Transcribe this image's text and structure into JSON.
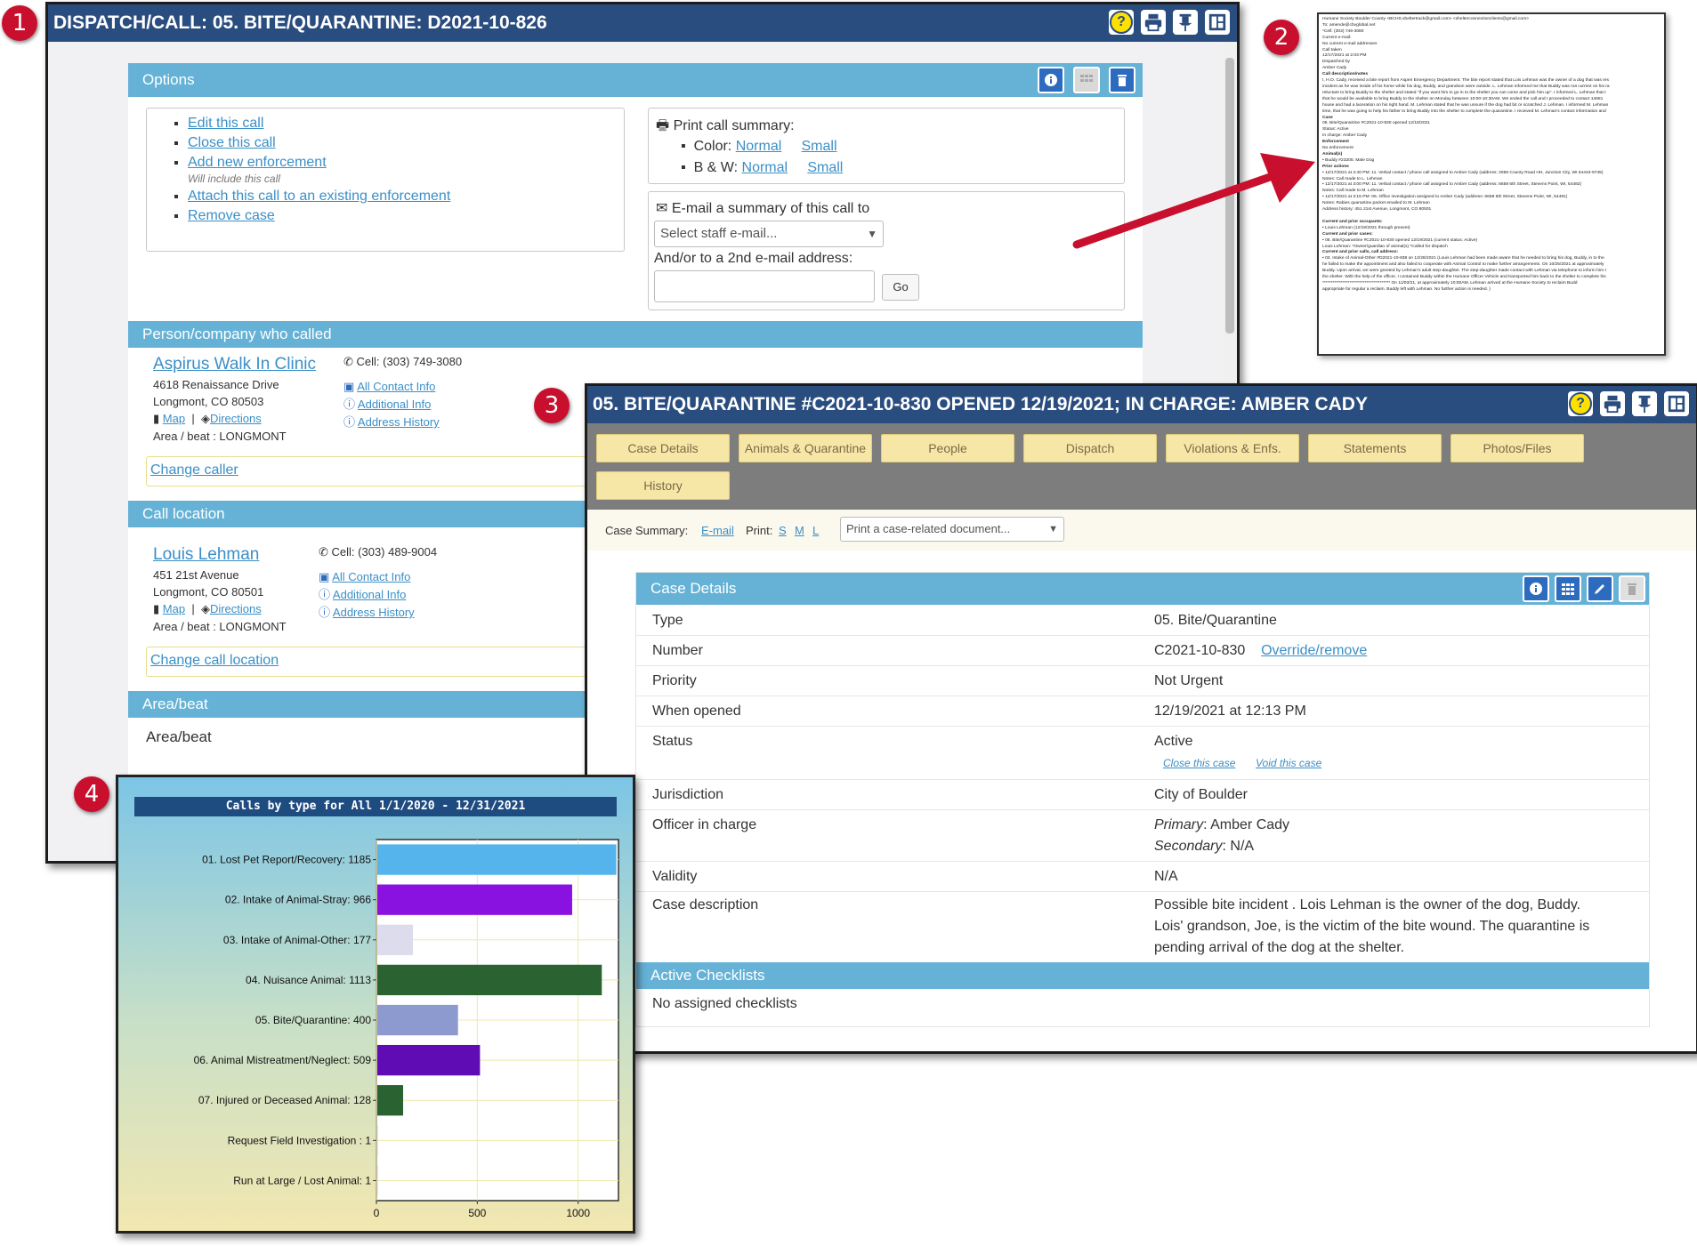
{
  "badges": [
    "1",
    "2",
    "3",
    "4"
  ],
  "dispatch": {
    "title": "DISPATCH/CALL: 05. BITE/QUARANTINE: D2021-10-826",
    "options_title": "Options",
    "options": [
      {
        "label": "Edit this call"
      },
      {
        "label": "Close this call"
      },
      {
        "label": "Add new enforcement",
        "note": "Will include this call"
      },
      {
        "label": "Attach this call to an existing enforcement"
      },
      {
        "label": "Remove case"
      }
    ],
    "print_summary": {
      "label": "Print call summary:",
      "color_label": "Color:",
      "normal": "Normal",
      "small": "Small",
      "bw_label": "B & W:"
    },
    "email_summary": {
      "label": "E-mail a summary of this call to",
      "select_placeholder": "Select staff e-mail...",
      "second_label": "And/or to a 2nd e-mail address:",
      "go": "Go"
    },
    "caller_section": "Person/company who called",
    "caller": {
      "name": "Aspirus Walk In Clinic",
      "address1": "4618 Renaissance Drive",
      "address2": "Longmont, CO 80503",
      "map": "Map",
      "sep": "|",
      "directions": "Directions",
      "area": "Area / beat : LONGMONT",
      "cell": "Cell: (303) 749-3080",
      "links": [
        "All Contact Info",
        "Additional Info",
        "Address History"
      ],
      "change": "Change caller"
    },
    "location_section": "Call location",
    "location": {
      "name": "Louis Lehman",
      "address1": "451 21st Avenue",
      "address2": "Longmont, CO 80501",
      "map": "Map",
      "sep": "|",
      "directions": "Directions",
      "area": "Area / beat : LONGMONT",
      "cell": "Cell: (303) 489-9004",
      "links": [
        "All Contact Info",
        "Additional Info",
        "Address History"
      ],
      "change": "Change call location"
    },
    "area_section": "Area/beat",
    "area_value": "Area/beat"
  },
  "email_doc": {
    "lines": [
      "Humane Society Boulder County <BCHS.sheltertrack@gmail.com> <shelterconnectionclients@gmail.com>",
      "To: amende@cbvglobal.net",
      "*Cell: (303) 749-3080",
      "Current e-mail:",
      "No current e-mail addresses",
      "Call taken",
      "12/17/2021 at 2:03 PM",
      "Dispatched by",
      "Amber Cady",
      "Call description/notes",
      "I, H.O. Cady, received a bite report from Aspen Emergency Department. The bite report stated that Lois Lehman was the owner of a dog that was res",
      "incident as he was inside of his home while his dog, Buddy, and grandson were outside. L. Lehman informed me that Buddy was not current on his ra",
      "reluctant to bring Buddy to the shelter and stated \"if you want him to go in to the shelter you can come and pick him up\". I informed L. Lehman that t",
      "that he would be available to bring Buddy to the shelter on Monday between 10:00-10:30AM. We ended the call and I proceeded to contact 14681",
      "house and had a laceration on his right hand. M. Lehman stated that he was unsure if the dog had bit or scratched J. Lehman. I informed M. Lehman",
      "time, that he was going to help his father to bring Buddy into the shelter to complete the quarantine. I received M. Lehman's contact information and",
      "Case",
      "05. Bite/Quarantine #C2021-10-830 opened 12/19/2021",
      "Status: Active",
      "In charge: Amber Cady",
      "Enforcement",
      "No enforcement",
      "Animal(s)",
      "• Buddy #23205: Male Dog",
      "Prior actions",
      "• 12/17/2021 at 2:40 PM: 11. Verbal contact / phone call assigned to Amber Cady (address: 2955 County Road HH, Junction City, WI 54443-9745)",
      "Notes: Call made to L. Lehman",
      "• 12/17/2021 at 3:00 PM: 11. Verbal contact / phone call assigned to Amber Cady (address: 6658 6th Street, Stevens Point, WI, 54482)",
      "Notes: Call made to M. Lehman",
      "• 12/17/2021 at 3:15 PM: 06. Office investigation assigned to Amber Cady (address: 6658 6th Street, Stevens Point, WI, 54481)",
      "Notes: Rabies quarantine packet emailed to M. Lehman",
      "Address history: 451 21st Avenue, Longmont, CO 80501",
      "",
      "Current and prior occupants:",
      "• Louis Lehman (12/19/2021 through present)",
      "Current and prior cases:",
      "• 05. Bite/Quarantine #C2021-10-830 opened 12/19/2021 (current status: Active)",
      "Louis Lehman: *Owner/guardian of animal(s) *Called for dispatch",
      "Current and prior calls, call address:",
      "• 03. Intake of Animal-Other #D2021-10-838 on 12/28/2021 (Louis Lehman had been made aware that he needed to bring his dog, Buddy, in to the",
      "he failed to make the appointment and also failed to cooperate with Animal Control to make further arrangements. On 10/25/2021 at approximately",
      "Buddy. Upon arrival, we were greeted by Lehman's adult step-daughter. The step-daughter made contact with Lehman via telephone to inform him t",
      "the shelter. With the help of the officer, I contained Buddy within the Humane Officer Vehicle and transported him back to the shelter to complete his",
      "**************************************** On 11/03/21, at approximately 10:00AM, Lehman arrived at the Humane Society to reclaim Budd",
      "appropriate for regular a reclaim. Buddy left with Lehman. No further action is needed. )"
    ]
  },
  "case": {
    "title": "05. BITE/QUARANTINE #C2021-10-830 OPENED 12/19/2021; IN CHARGE: AMBER CADY",
    "tabs": [
      "Case Details",
      "Animals & Quarantine",
      "People",
      "Dispatch",
      "Violations & Enfs.",
      "Statements",
      "Photos/Files",
      "History"
    ],
    "summary_label": "Case Summary:",
    "email": "E-mail",
    "print_label": "Print:",
    "print_s": "S",
    "print_m": "M",
    "print_l": "L",
    "doc_select": "Print a case-related document...",
    "details_title": "Case Details",
    "rows": {
      "type": {
        "k": "Type",
        "v": "05. Bite/Quarantine"
      },
      "number": {
        "k": "Number",
        "v": "C2021-10-830",
        "link": "Override/remove"
      },
      "priority": {
        "k": "Priority",
        "v": "Not Urgent"
      },
      "opened": {
        "k": "When opened",
        "v": "12/19/2021 at 12:13 PM"
      },
      "status": {
        "k": "Status",
        "v": "Active",
        "close": "Close this case",
        "void": "Void this case"
      },
      "jurisdiction": {
        "k": "Jurisdiction",
        "v": "City of Boulder"
      },
      "officer": {
        "k": "Officer in charge",
        "primary_label": "Primary",
        "primary": ": Amber Cady",
        "secondary_label": "Secondary",
        "secondary": ": N/A"
      },
      "validity": {
        "k": "Validity",
        "v": "N/A"
      },
      "description": {
        "k": "Case description",
        "v1": "Possible bite incident . Lois Lehman is the owner of the dog, Buddy.",
        "v2": "Lois' grandson, Joe, is the victim of the bite wound. The quarantine is",
        "v3": "pending arrival of the dog at the shelter."
      }
    },
    "checklists_title": "Active Checklists",
    "checklists_value": "No assigned checklists"
  },
  "chart_data": {
    "type": "bar",
    "orientation": "horizontal",
    "title": "Calls by type for All 1/1/2020 - 12/31/2021",
    "categories": [
      "01. Lost Pet Report/Recovery: 1185",
      "02. Intake of Animal-Stray: 966",
      "03. Intake of Animal-Other: 177",
      "04. Nuisance Animal: 1113",
      "05. Bite/Quarantine: 400",
      "06. Animal Mistreatment/Neglect: 509",
      "07. Injured or Deceased Animal: 128",
      "Request Field Investigation : 1",
      "Run at Large / Lost Animal: 1"
    ],
    "values": [
      1185,
      966,
      177,
      1113,
      400,
      509,
      128,
      1,
      1
    ],
    "colors": [
      "#55b4ec",
      "#8a12e0",
      "#dcdcec",
      "#2a6232",
      "#8c9ad0",
      "#5f0cb4",
      "#2a6232",
      "#55b4ec",
      "#55b4ec"
    ],
    "xlim": [
      0,
      1200
    ],
    "xticks": [
      0,
      500,
      1000
    ],
    "grid": true
  }
}
